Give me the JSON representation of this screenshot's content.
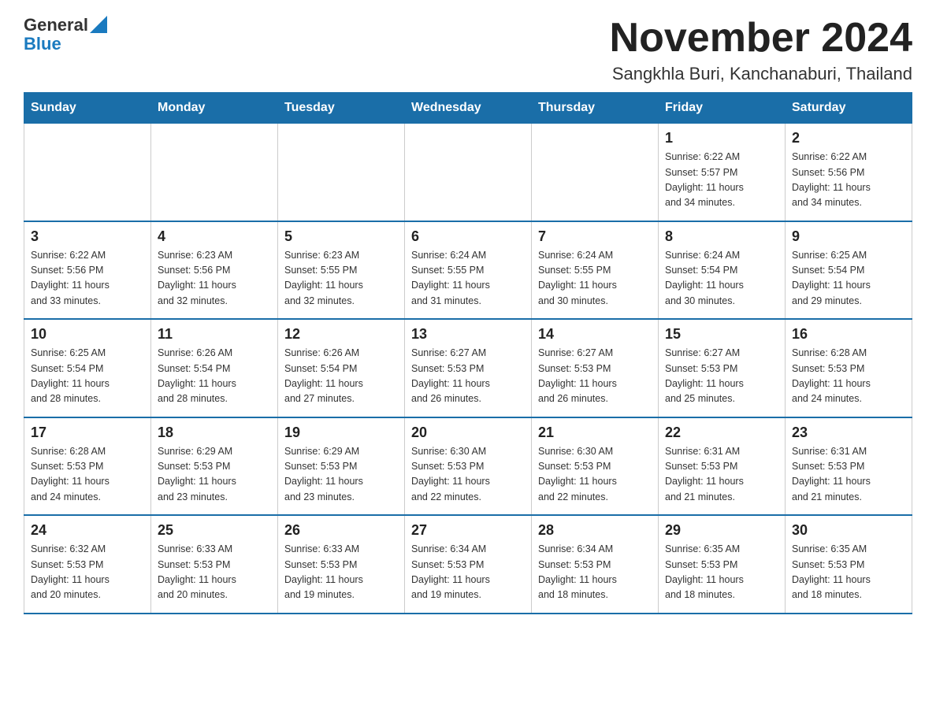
{
  "header": {
    "logo_general": "General",
    "logo_blue": "Blue",
    "month_title": "November 2024",
    "location": "Sangkhla Buri, Kanchanaburi, Thailand"
  },
  "days_of_week": [
    "Sunday",
    "Monday",
    "Tuesday",
    "Wednesday",
    "Thursday",
    "Friday",
    "Saturday"
  ],
  "weeks": [
    [
      {
        "day": "",
        "info": ""
      },
      {
        "day": "",
        "info": ""
      },
      {
        "day": "",
        "info": ""
      },
      {
        "day": "",
        "info": ""
      },
      {
        "day": "",
        "info": ""
      },
      {
        "day": "1",
        "info": "Sunrise: 6:22 AM\nSunset: 5:57 PM\nDaylight: 11 hours\nand 34 minutes."
      },
      {
        "day": "2",
        "info": "Sunrise: 6:22 AM\nSunset: 5:56 PM\nDaylight: 11 hours\nand 34 minutes."
      }
    ],
    [
      {
        "day": "3",
        "info": "Sunrise: 6:22 AM\nSunset: 5:56 PM\nDaylight: 11 hours\nand 33 minutes."
      },
      {
        "day": "4",
        "info": "Sunrise: 6:23 AM\nSunset: 5:56 PM\nDaylight: 11 hours\nand 32 minutes."
      },
      {
        "day": "5",
        "info": "Sunrise: 6:23 AM\nSunset: 5:55 PM\nDaylight: 11 hours\nand 32 minutes."
      },
      {
        "day": "6",
        "info": "Sunrise: 6:24 AM\nSunset: 5:55 PM\nDaylight: 11 hours\nand 31 minutes."
      },
      {
        "day": "7",
        "info": "Sunrise: 6:24 AM\nSunset: 5:55 PM\nDaylight: 11 hours\nand 30 minutes."
      },
      {
        "day": "8",
        "info": "Sunrise: 6:24 AM\nSunset: 5:54 PM\nDaylight: 11 hours\nand 30 minutes."
      },
      {
        "day": "9",
        "info": "Sunrise: 6:25 AM\nSunset: 5:54 PM\nDaylight: 11 hours\nand 29 minutes."
      }
    ],
    [
      {
        "day": "10",
        "info": "Sunrise: 6:25 AM\nSunset: 5:54 PM\nDaylight: 11 hours\nand 28 minutes."
      },
      {
        "day": "11",
        "info": "Sunrise: 6:26 AM\nSunset: 5:54 PM\nDaylight: 11 hours\nand 28 minutes."
      },
      {
        "day": "12",
        "info": "Sunrise: 6:26 AM\nSunset: 5:54 PM\nDaylight: 11 hours\nand 27 minutes."
      },
      {
        "day": "13",
        "info": "Sunrise: 6:27 AM\nSunset: 5:53 PM\nDaylight: 11 hours\nand 26 minutes."
      },
      {
        "day": "14",
        "info": "Sunrise: 6:27 AM\nSunset: 5:53 PM\nDaylight: 11 hours\nand 26 minutes."
      },
      {
        "day": "15",
        "info": "Sunrise: 6:27 AM\nSunset: 5:53 PM\nDaylight: 11 hours\nand 25 minutes."
      },
      {
        "day": "16",
        "info": "Sunrise: 6:28 AM\nSunset: 5:53 PM\nDaylight: 11 hours\nand 24 minutes."
      }
    ],
    [
      {
        "day": "17",
        "info": "Sunrise: 6:28 AM\nSunset: 5:53 PM\nDaylight: 11 hours\nand 24 minutes."
      },
      {
        "day": "18",
        "info": "Sunrise: 6:29 AM\nSunset: 5:53 PM\nDaylight: 11 hours\nand 23 minutes."
      },
      {
        "day": "19",
        "info": "Sunrise: 6:29 AM\nSunset: 5:53 PM\nDaylight: 11 hours\nand 23 minutes."
      },
      {
        "day": "20",
        "info": "Sunrise: 6:30 AM\nSunset: 5:53 PM\nDaylight: 11 hours\nand 22 minutes."
      },
      {
        "day": "21",
        "info": "Sunrise: 6:30 AM\nSunset: 5:53 PM\nDaylight: 11 hours\nand 22 minutes."
      },
      {
        "day": "22",
        "info": "Sunrise: 6:31 AM\nSunset: 5:53 PM\nDaylight: 11 hours\nand 21 minutes."
      },
      {
        "day": "23",
        "info": "Sunrise: 6:31 AM\nSunset: 5:53 PM\nDaylight: 11 hours\nand 21 minutes."
      }
    ],
    [
      {
        "day": "24",
        "info": "Sunrise: 6:32 AM\nSunset: 5:53 PM\nDaylight: 11 hours\nand 20 minutes."
      },
      {
        "day": "25",
        "info": "Sunrise: 6:33 AM\nSunset: 5:53 PM\nDaylight: 11 hours\nand 20 minutes."
      },
      {
        "day": "26",
        "info": "Sunrise: 6:33 AM\nSunset: 5:53 PM\nDaylight: 11 hours\nand 19 minutes."
      },
      {
        "day": "27",
        "info": "Sunrise: 6:34 AM\nSunset: 5:53 PM\nDaylight: 11 hours\nand 19 minutes."
      },
      {
        "day": "28",
        "info": "Sunrise: 6:34 AM\nSunset: 5:53 PM\nDaylight: 11 hours\nand 18 minutes."
      },
      {
        "day": "29",
        "info": "Sunrise: 6:35 AM\nSunset: 5:53 PM\nDaylight: 11 hours\nand 18 minutes."
      },
      {
        "day": "30",
        "info": "Sunrise: 6:35 AM\nSunset: 5:53 PM\nDaylight: 11 hours\nand 18 minutes."
      }
    ]
  ]
}
